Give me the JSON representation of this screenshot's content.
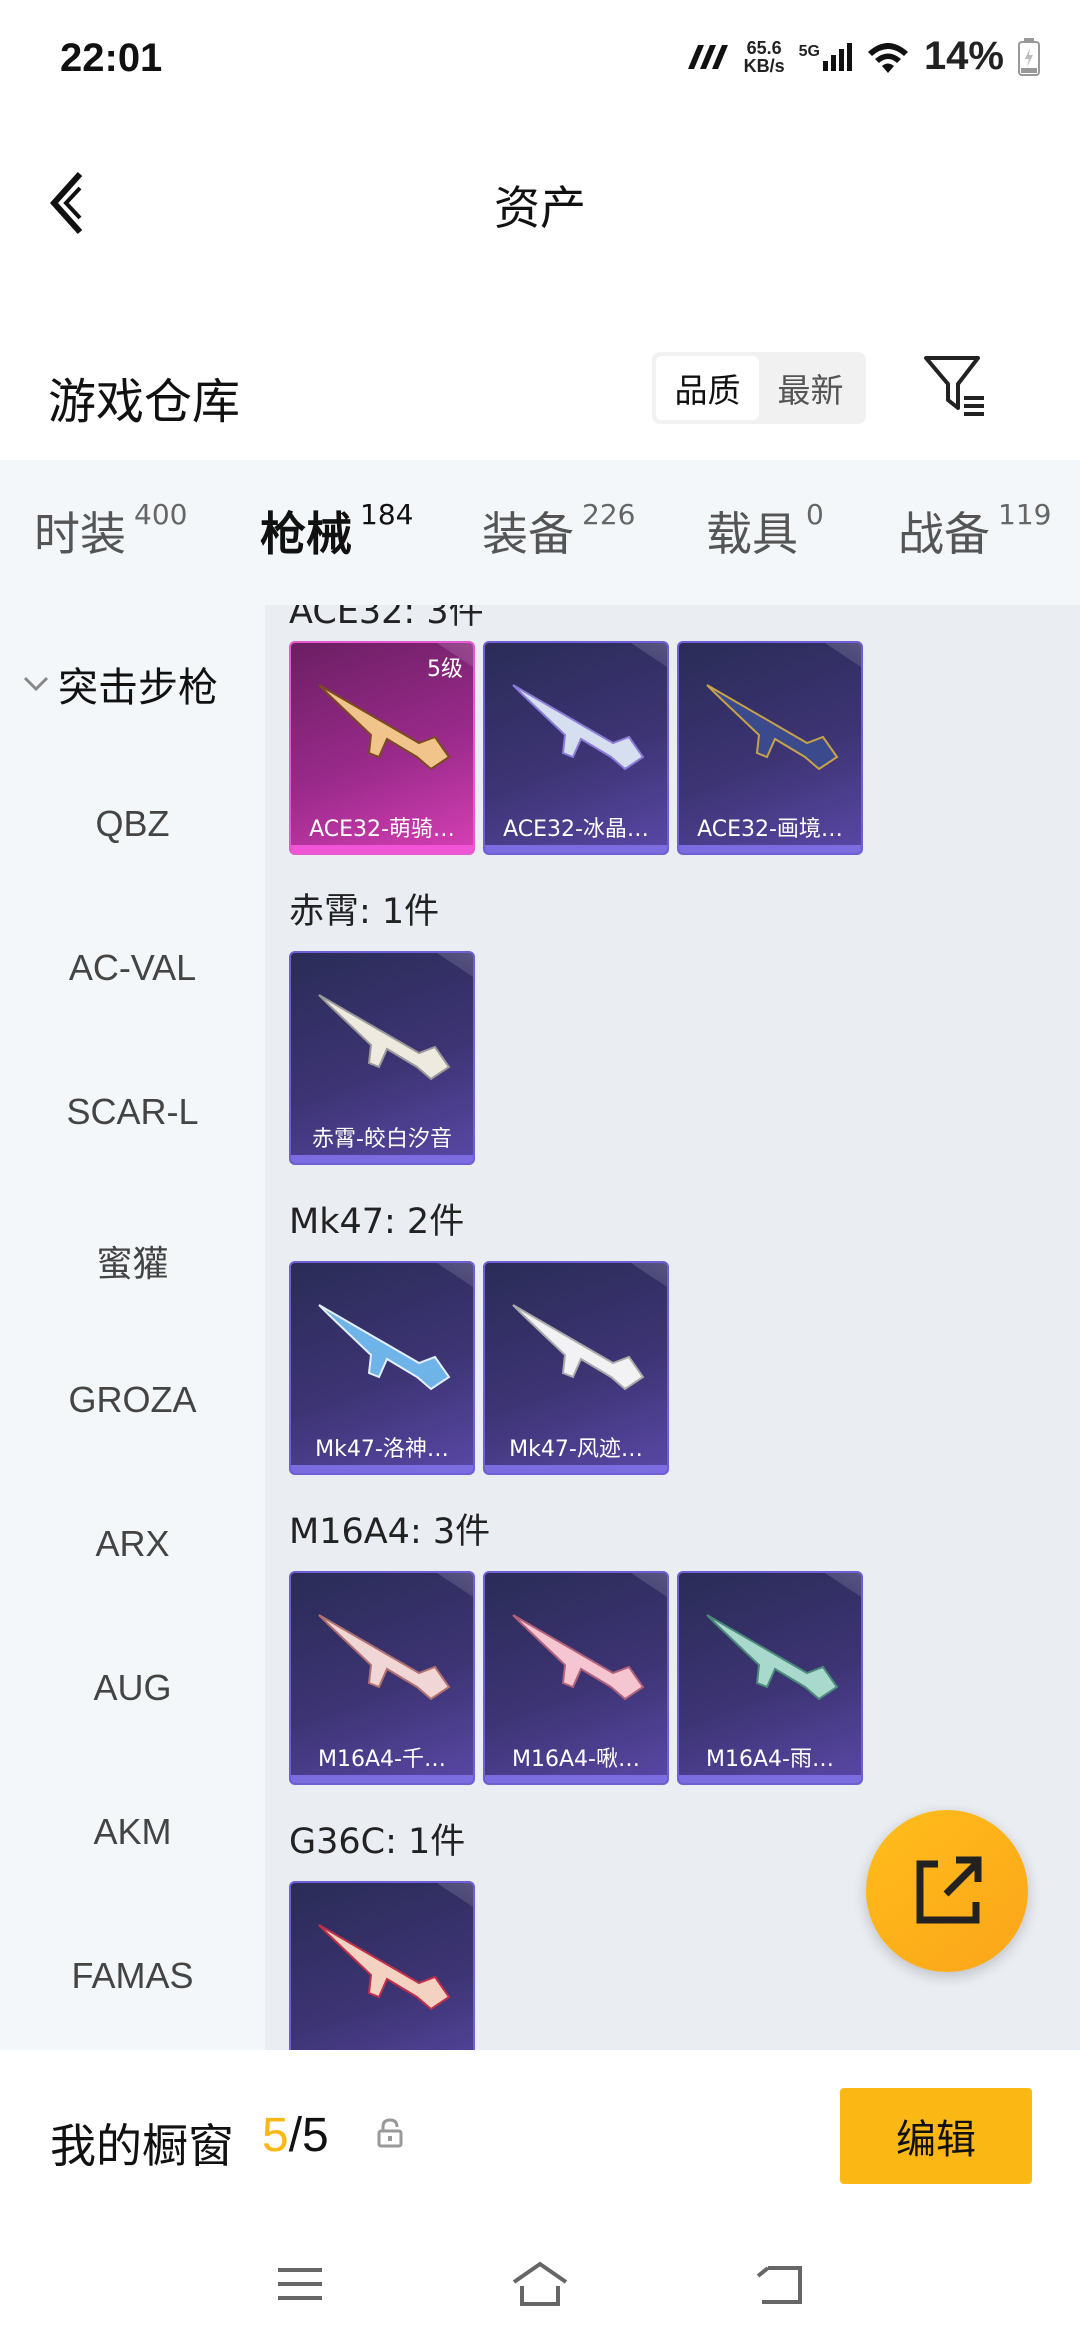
{
  "status": {
    "time": "22:01",
    "speed_value": "65.6",
    "speed_unit": "KB/s",
    "network": "5G",
    "battery": "14%"
  },
  "header": {
    "title": "资产"
  },
  "warehouse": {
    "title": "游戏仓库",
    "sort_quality": "品质",
    "sort_newest": "最新"
  },
  "tabs": [
    {
      "label": "时装",
      "count": "400"
    },
    {
      "label": "枪械",
      "count": "184"
    },
    {
      "label": "装备",
      "count": "226"
    },
    {
      "label": "载具",
      "count": "0"
    },
    {
      "label": "战备",
      "count": "119"
    }
  ],
  "sidebar": {
    "category": "突击步枪",
    "items": [
      "QBZ",
      "AC-VAL",
      "SCAR-L",
      "蜜獾",
      "GROZA",
      "ARX",
      "AUG",
      "AKM",
      "FAMAS"
    ]
  },
  "groups": [
    {
      "label": "ACE32: 3件",
      "items": [
        {
          "name": "ACE32-萌骑…",
          "level": "5级"
        },
        {
          "name": "ACE32-冰晶…"
        },
        {
          "name": "ACE32-画境…"
        }
      ]
    },
    {
      "label": "赤霄: 1件",
      "items": [
        {
          "name": "赤霄-皎白汐音"
        }
      ]
    },
    {
      "label": "Mk47: 2件",
      "items": [
        {
          "name": "Mk47-洛神…"
        },
        {
          "name": "Mk47-风迹…"
        }
      ]
    },
    {
      "label": "M16A4: 3件",
      "items": [
        {
          "name": "M16A4-千…"
        },
        {
          "name": "M16A4-啾…"
        },
        {
          "name": "M16A4-雨…"
        }
      ]
    },
    {
      "label": "G36C: 1件",
      "items": [
        {
          "name": ""
        }
      ]
    }
  ],
  "showcase": {
    "label": "我的橱窗",
    "current": "5",
    "total": "/5",
    "edit_label": "编辑"
  },
  "colors": {
    "accent": "#fbb814",
    "card_purple": "#3d3474",
    "card_pink": "#9a2a8b"
  },
  "icons": [
    "back-icon",
    "filter-icon",
    "lock-icon",
    "share-icon",
    "menu-icon",
    "home-icon",
    "return-icon"
  ]
}
